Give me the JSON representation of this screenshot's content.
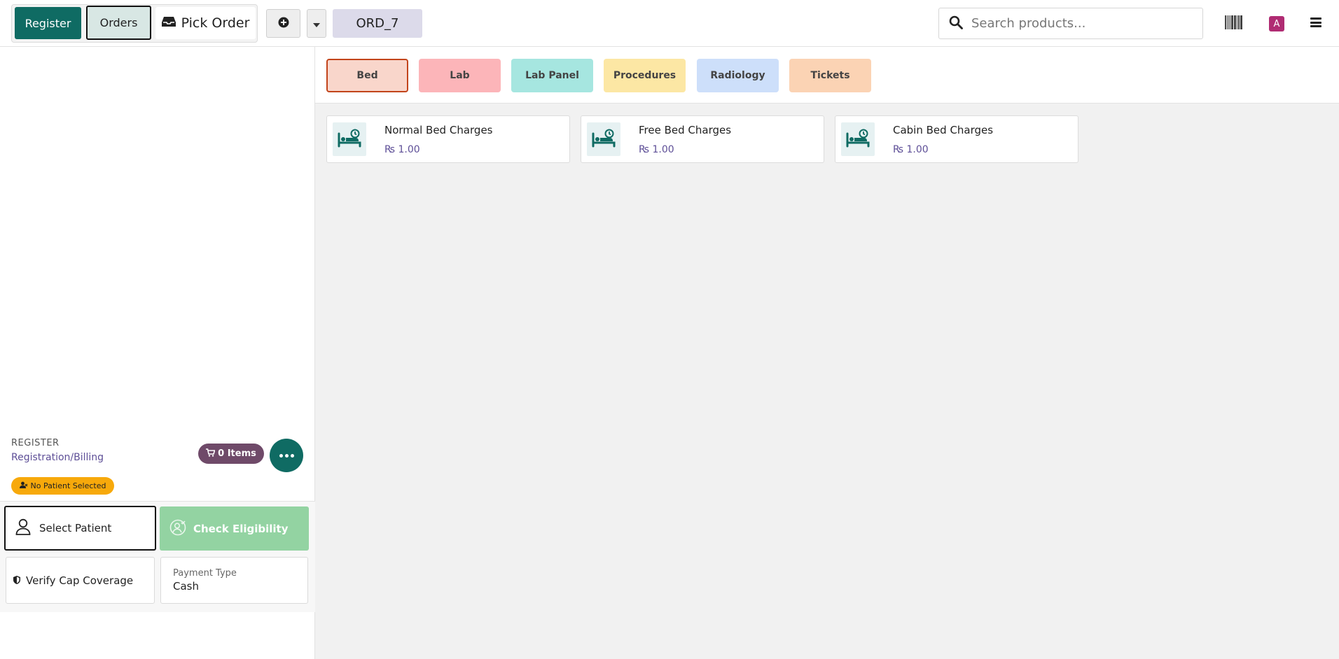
{
  "header": {
    "register_label": "Register",
    "orders_label": "Orders",
    "pick_order_label": "Pick Order",
    "order_tag": "ORD_7",
    "search_placeholder": "Search products...",
    "avatar_letter": "A"
  },
  "categories": [
    {
      "label": "Bed",
      "color": "#f9d6cb"
    },
    {
      "label": "Lab",
      "color": "#fcb5b9"
    },
    {
      "label": "Lab Panel",
      "color": "#a6e6e0"
    },
    {
      "label": "Procedures",
      "color": "#fce7a4"
    },
    {
      "label": "Radiology",
      "color": "#cddffa"
    },
    {
      "label": "Tickets",
      "color": "#fbd3b4"
    }
  ],
  "products": [
    {
      "name": "Normal Bed Charges",
      "currency": "₨",
      "price": "1.00",
      "icon": "bed-icon"
    },
    {
      "name": "Free Bed Charges",
      "currency": "₨",
      "price": "1.00",
      "icon": "bed-icon"
    },
    {
      "name": "Cabin Bed Charges",
      "currency": "₨",
      "price": "1.00",
      "icon": "bed-icon"
    }
  ],
  "cart": {
    "register_caption": "REGISTER",
    "register_name": "Registration/Billing",
    "items_count": "0 Items",
    "patient_status": "No Patient Selected"
  },
  "actions": {
    "select_patient": "Select Patient",
    "check_eligibility": "Check Eligibility",
    "verify_cap": "Verify Cap Coverage",
    "payment_type_label": "Payment Type",
    "payment_type_value": "Cash"
  },
  "colors": {
    "primary": "#0f6b63",
    "selected_category_border": "#c2441b",
    "items_badge": "#6f4a69",
    "patient_warning": "#f7a90b",
    "eligibility_button": "#93d3a2",
    "price_text": "#5e4f97",
    "avatar": "#b02c73"
  }
}
